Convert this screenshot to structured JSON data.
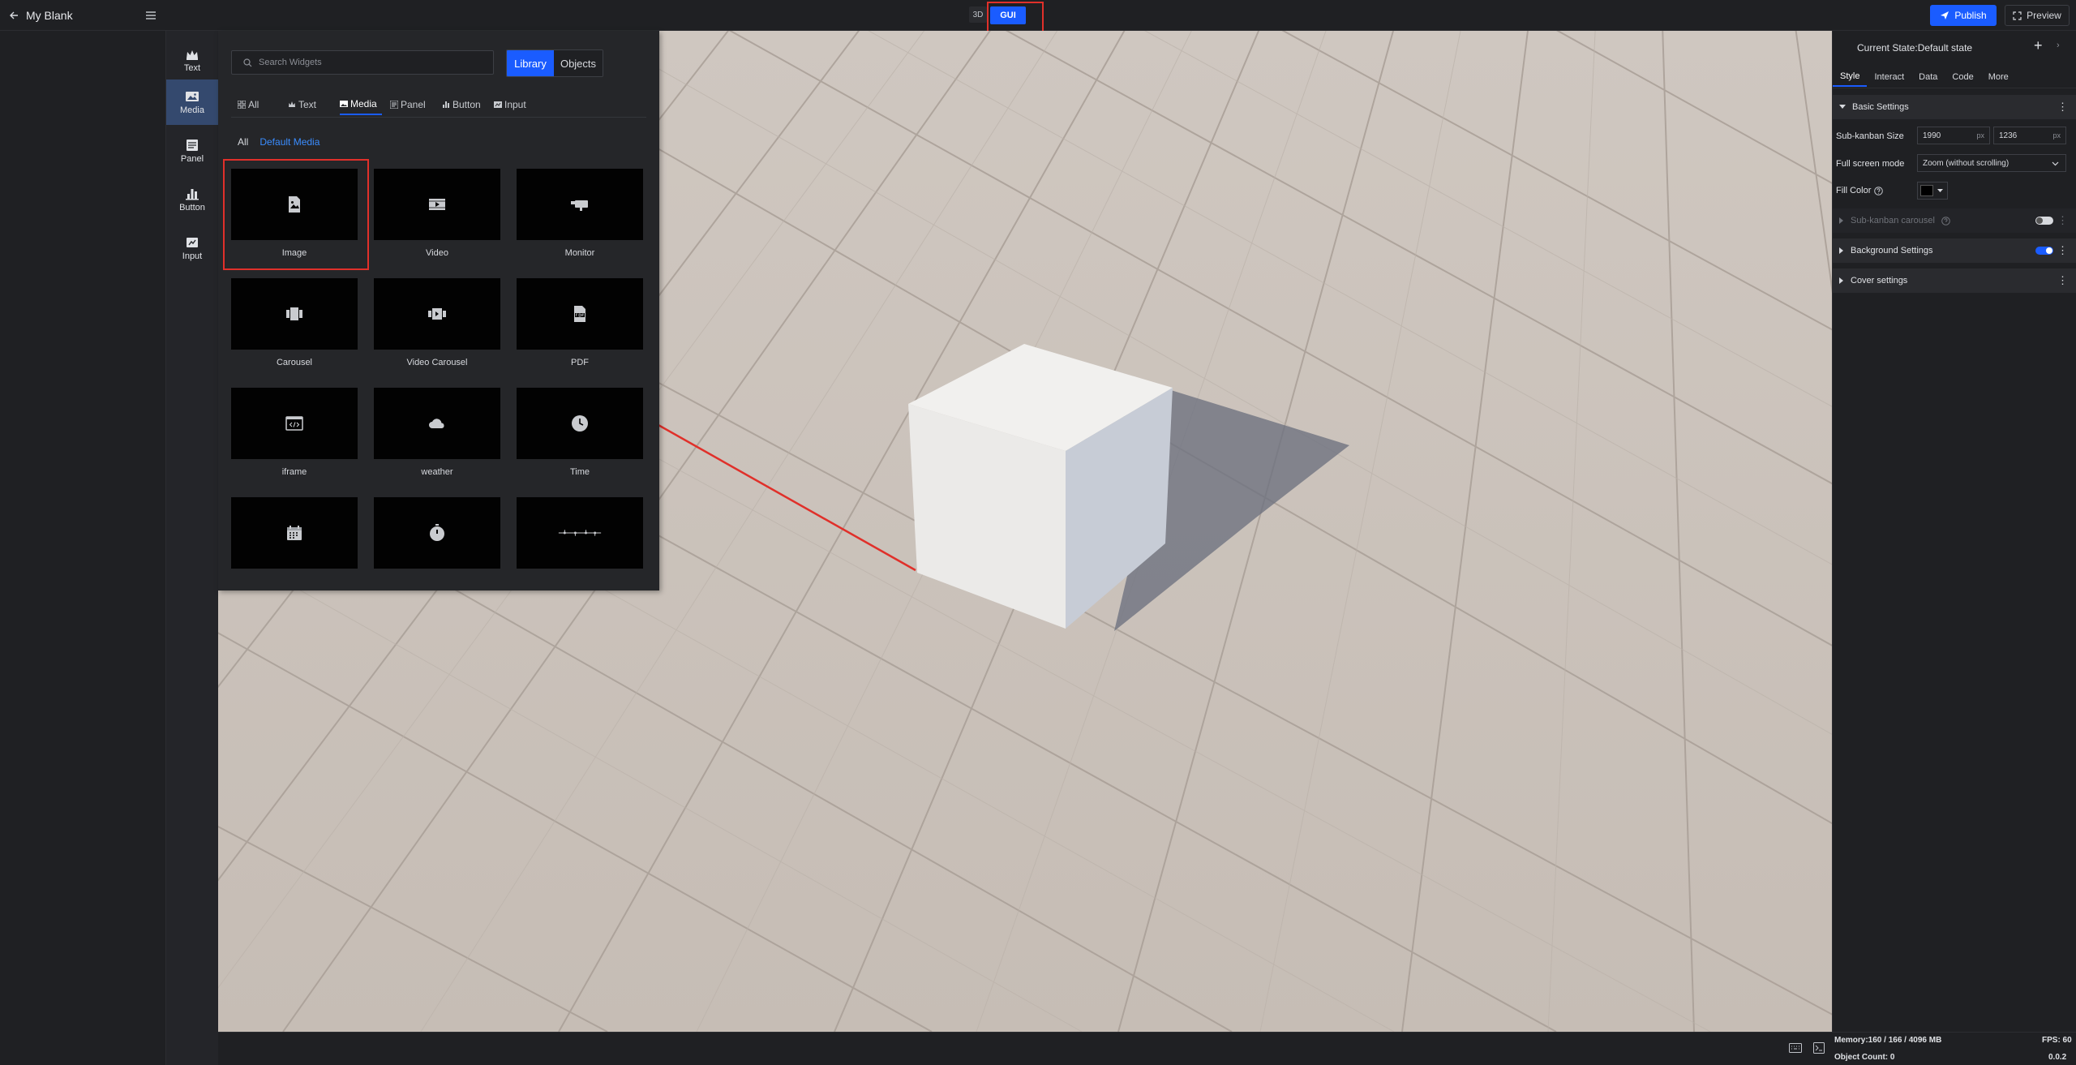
{
  "app": {
    "project_title": "My Blank"
  },
  "toolbar": {
    "mode_3d": "3D",
    "mode_gui": "GUI",
    "publish_label": "Publish",
    "preview_label": "Preview"
  },
  "categories": [
    {
      "label": "Text",
      "icon": "crown-icon",
      "active": false
    },
    {
      "label": "Media",
      "icon": "image-icon",
      "active": true
    },
    {
      "label": "Panel",
      "icon": "panel-icon",
      "active": false
    },
    {
      "label": "Button",
      "icon": "bar-chart-icon",
      "active": false
    },
    {
      "label": "Input",
      "icon": "input-icon",
      "active": false
    }
  ],
  "widgets": {
    "search_placeholder": "Search Widgets",
    "segment": {
      "library": "Library",
      "objects": "Objects"
    },
    "tabs": [
      "All",
      "Text",
      "Media",
      "Panel",
      "Button",
      "Input"
    ],
    "active_tab": "Media",
    "subfilters": [
      "All",
      "Default Media"
    ],
    "items": [
      {
        "label": "Image",
        "icon": "image-icon"
      },
      {
        "label": "Video",
        "icon": "video-icon"
      },
      {
        "label": "Monitor",
        "icon": "camera-icon"
      },
      {
        "label": "Carousel",
        "icon": "carousel-icon"
      },
      {
        "label": "Video Carousel",
        "icon": "video-carousel-icon"
      },
      {
        "label": "PDF",
        "icon": "pdf-icon"
      },
      {
        "label": "iframe",
        "icon": "code-icon"
      },
      {
        "label": "weather",
        "icon": "cloud-icon"
      },
      {
        "label": "Time",
        "icon": "clock-icon"
      },
      {
        "label": "",
        "icon": "calendar-icon"
      },
      {
        "label": "",
        "icon": "timer-icon"
      },
      {
        "label": "",
        "icon": "timeline-icon"
      }
    ]
  },
  "right_panel": {
    "state_title": "Current State:Default state",
    "tabs": [
      "Style",
      "Interact",
      "Data",
      "Code",
      "More"
    ],
    "active_tab": "Style",
    "basic_settings": "Basic Settings",
    "sub_kanban_size_label": "Sub-kanban Size",
    "width": "1990",
    "height": "1236",
    "unit": "px",
    "fullscreen_label": "Full screen mode",
    "fullscreen_value": "Zoom (without scrolling)",
    "fill_color_label": "Fill Color",
    "fill_color": "#000000",
    "sub_carousel_label": "Sub-kanban carousel",
    "sub_carousel_enabled": false,
    "background_settings": "Background Settings",
    "background_enabled": true,
    "cover_settings": "Cover settings"
  },
  "status": {
    "memory": "Memory:160 / 166 / 4096 MB",
    "object_count": "Object Count: 0",
    "fps": "FPS: 60",
    "version": "0.0.2"
  },
  "colors": {
    "accent": "#1a5cff",
    "highlight": "#e0302a"
  }
}
